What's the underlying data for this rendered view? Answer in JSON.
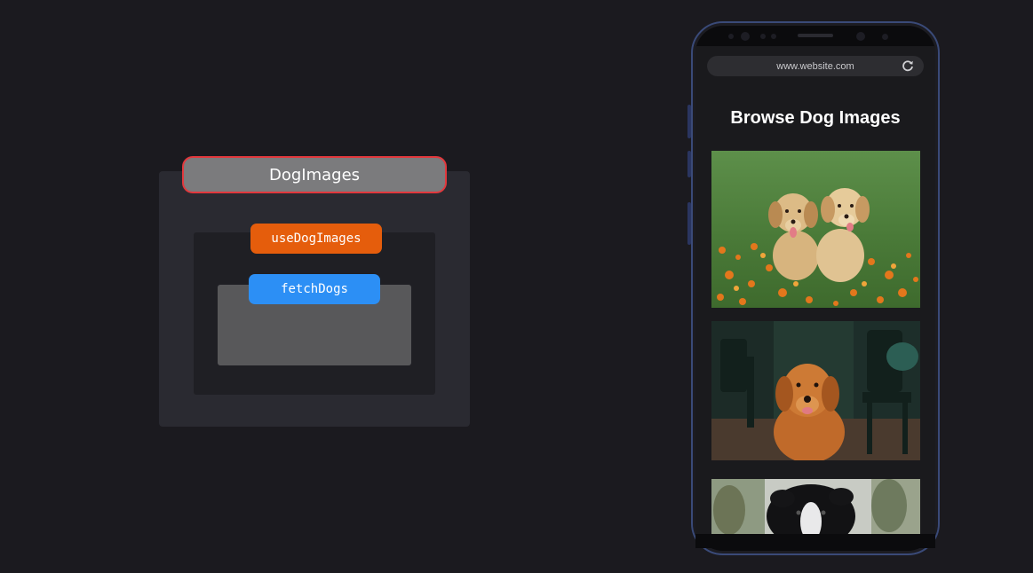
{
  "diagram": {
    "component_label": "DogImages",
    "hook_label": "useDogImages",
    "function_label": "fetchDogs"
  },
  "phone": {
    "url": "www.website.com",
    "page_title": "Browse Dog Images",
    "images": [
      {
        "name": "two-golden-puppies-photo"
      },
      {
        "name": "golden-retriever-photo"
      },
      {
        "name": "border-collie-photo"
      }
    ]
  },
  "colors": {
    "background": "#1b1a1f",
    "component_fill": "#7b7b7d",
    "component_border": "#e2383d",
    "hook": "#e55d0c",
    "function": "#2c8ff5"
  },
  "icons": [
    "reload-icon"
  ]
}
